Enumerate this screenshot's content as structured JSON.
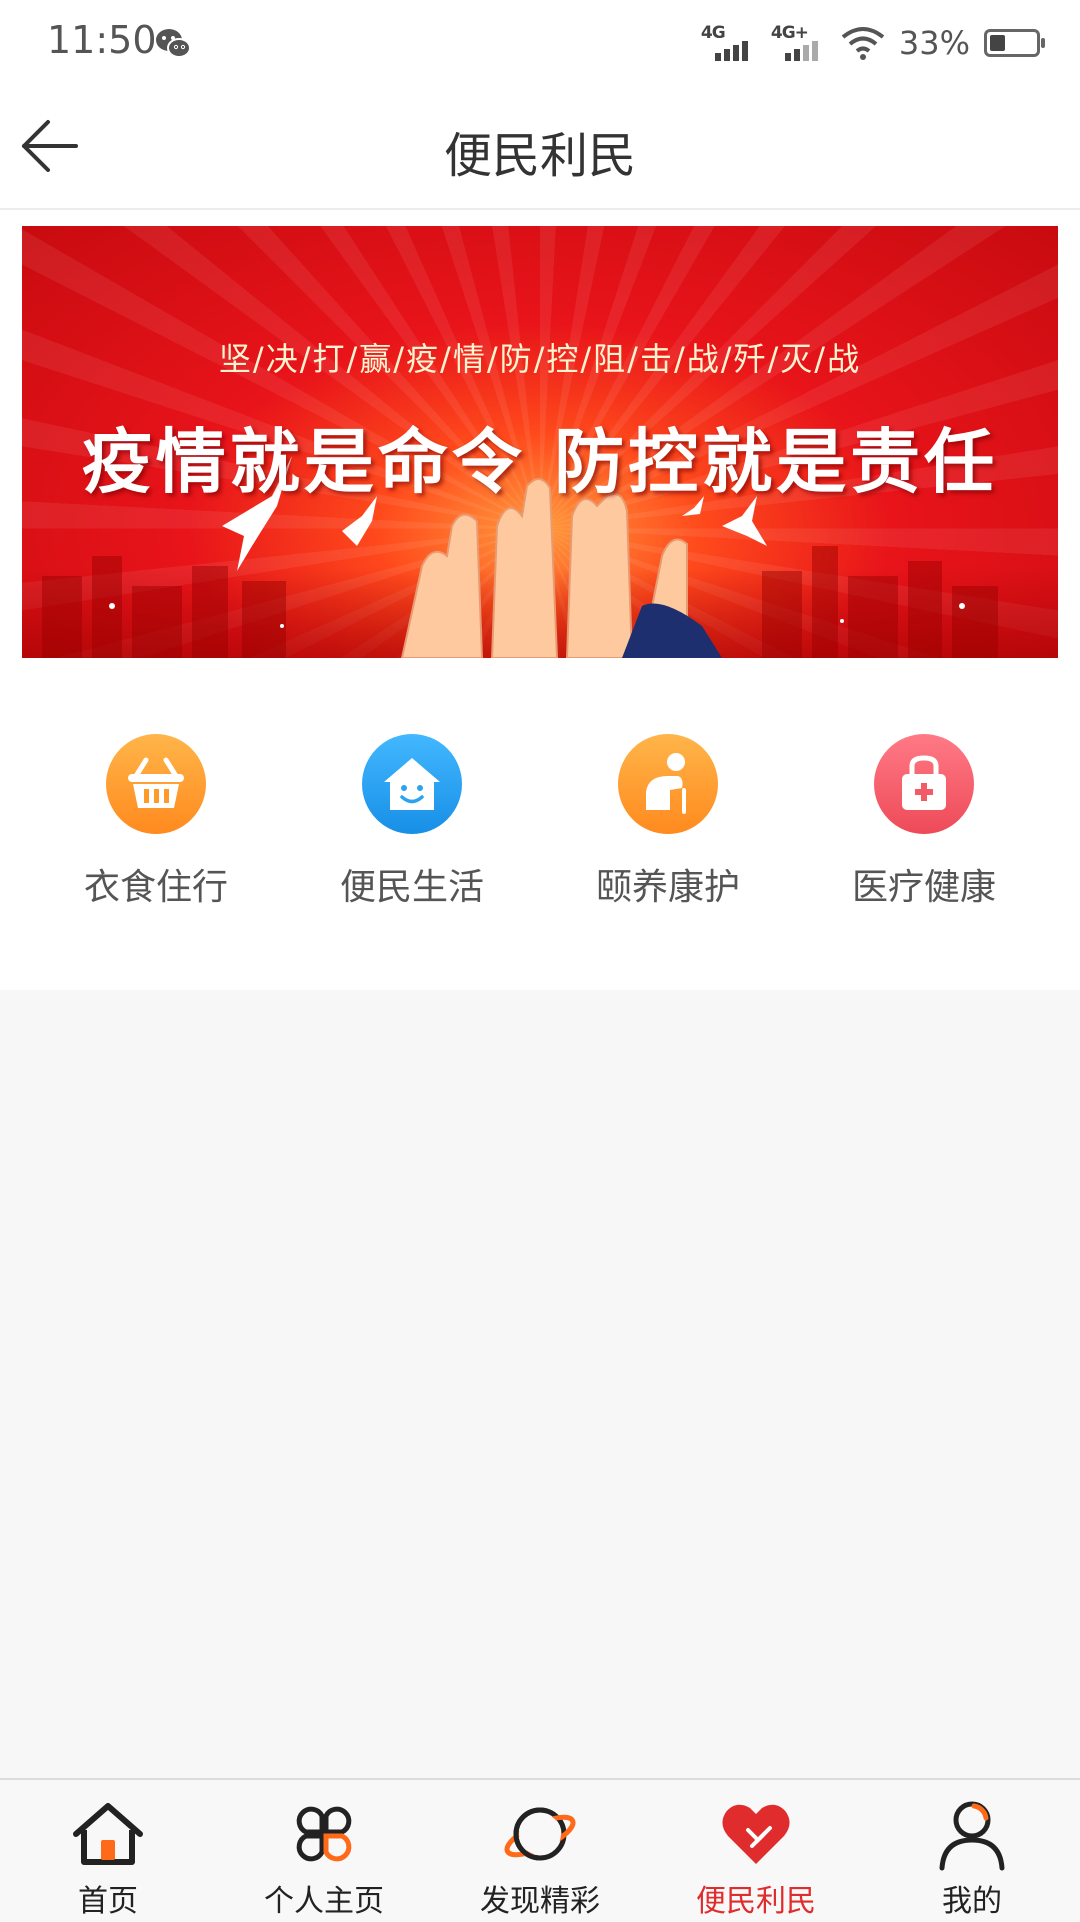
{
  "status_bar": {
    "time": "11:50",
    "network_1": "4G",
    "network_2": "4G+",
    "battery": "33%",
    "icons": [
      "wechat-icon",
      "signal-icon",
      "wifi-icon",
      "battery-icon"
    ]
  },
  "nav": {
    "title": "便民利民",
    "back_icon": "arrow-left-icon"
  },
  "banner": {
    "subtitle": "坚/决/打/赢/疫/情/防/控/阻/击/战/歼/灭/战",
    "headline": "疫情就是命令  防控就是责任",
    "colors": {
      "primary": "#e8141a",
      "glow": "#ff9a3c"
    }
  },
  "services": [
    {
      "label": "衣食住行",
      "icon": "basket-icon",
      "color": "#ff9a2a"
    },
    {
      "label": "便民生活",
      "icon": "house-smile-icon",
      "color": "#2aa3f0"
    },
    {
      "label": "颐养康护",
      "icon": "elderly-care-icon",
      "color": "#ff9a2a"
    },
    {
      "label": "医疗健康",
      "icon": "medical-bag-icon",
      "color": "#f25a68"
    }
  ],
  "tabs": [
    {
      "label": "首页",
      "icon": "home-icon",
      "active": false
    },
    {
      "label": "个人主页",
      "icon": "clover-icon",
      "active": false
    },
    {
      "label": "发现精彩",
      "icon": "planet-icon",
      "active": false
    },
    {
      "label": "便民利民",
      "icon": "heart-hand-icon",
      "active": true
    },
    {
      "label": "我的",
      "icon": "user-icon",
      "active": false
    }
  ],
  "accent_color": "#e02c2c"
}
